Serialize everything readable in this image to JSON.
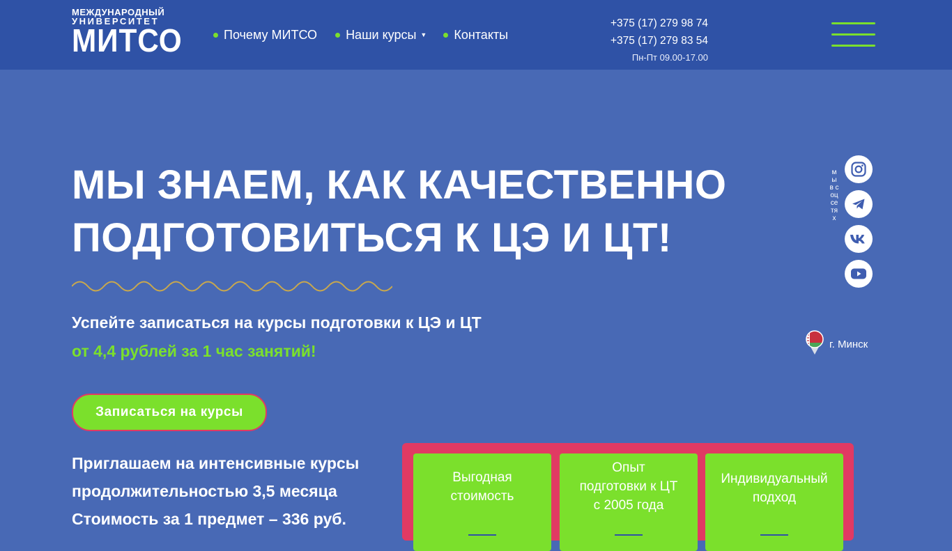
{
  "header": {
    "logo": {
      "line1": "МЕЖДУНАРОДНЫЙ",
      "line2": "УНИВЕРСИТЕТ",
      "line3": "МИТСО"
    },
    "nav": [
      {
        "label": "Почему МИТСО"
      },
      {
        "label": "Наши курсы"
      },
      {
        "label": "Контакты"
      }
    ],
    "phones": [
      "+375 (17) 279 98 74",
      "+375 (17) 279 83 54"
    ],
    "hours": "Пн-Пт 09.00-17.00"
  },
  "hero": {
    "title_line1": "МЫ ЗНАЕМ, КАК КАЧЕСТВЕННО",
    "title_line2": "ПОДГОТОВИТЬСЯ К ЦЭ И ЦТ!",
    "subtitle": "Успейте записаться на курсы подготовки к ЦЭ и ЦТ",
    "price_note": "от 4,4 рублей за 1 час занятий!",
    "cta_label": "Записаться на курсы",
    "intro_lines": [
      "Приглашаем на интенсивные курсы",
      "продолжительностью 3,5 месяца",
      "Стоимость за 1 предмет – 336 руб."
    ]
  },
  "social": {
    "label": "мы в соцсетях",
    "icons": [
      "instagram-icon",
      "telegram-icon",
      "vk-icon",
      "youtube-icon"
    ]
  },
  "city": {
    "label": "г. Минск"
  },
  "features": [
    {
      "lines": [
        "Выгодная",
        "стоимость"
      ]
    },
    {
      "lines": [
        "Опыт",
        "подготовки к ЦТ",
        "с 2005 года"
      ]
    },
    {
      "lines": [
        "Индивидуальный",
        "подход"
      ]
    }
  ],
  "colors": {
    "header_bg": "#2f52a6",
    "page_bg": "#4869b5",
    "accent_green": "#7be02c",
    "accent_pink": "#e13a63",
    "wave": "#c9a84d"
  }
}
